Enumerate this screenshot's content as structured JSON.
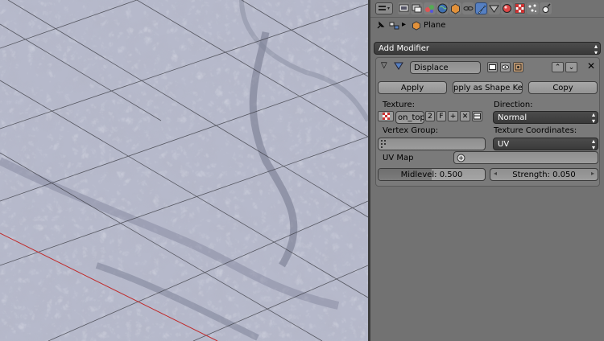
{
  "icons": {
    "editor_type": "properties-editor-icon",
    "tabs": [
      "render-icon",
      "render-layers-icon",
      "scene-icon",
      "world-icon",
      "object-icon",
      "constraints-icon",
      "modifiers-icon",
      "data-icon",
      "material-icon",
      "texture-icon",
      "particles-icon",
      "physics-icon"
    ]
  },
  "context": {
    "object_name": "Plane"
  },
  "toolbar": {
    "add_modifier": "Add Modifier"
  },
  "modifier": {
    "name": "Displace",
    "apply": "Apply",
    "apply_shape_key": "Apply as Shape Key",
    "copy": "Copy",
    "texture_label": "Texture:",
    "texture_name": "on_topo",
    "texture_users": "2",
    "texture_fake": "F",
    "direction_label": "Direction:",
    "direction_value": "Normal",
    "vertex_group_label": "Vertex Group:",
    "vertex_group_value": "",
    "texture_coords_label": "Texture Coordinates:",
    "texture_coords_value": "UV",
    "uv_map_label": "UV Map",
    "uv_map_value": "",
    "midlevel": "Midlevel: 0.500",
    "strength": "Strength: 0.050"
  },
  "colors": {
    "active_tab": "#5680c2",
    "panel_bg": "#727272",
    "terrain": "#b4b7c9"
  }
}
